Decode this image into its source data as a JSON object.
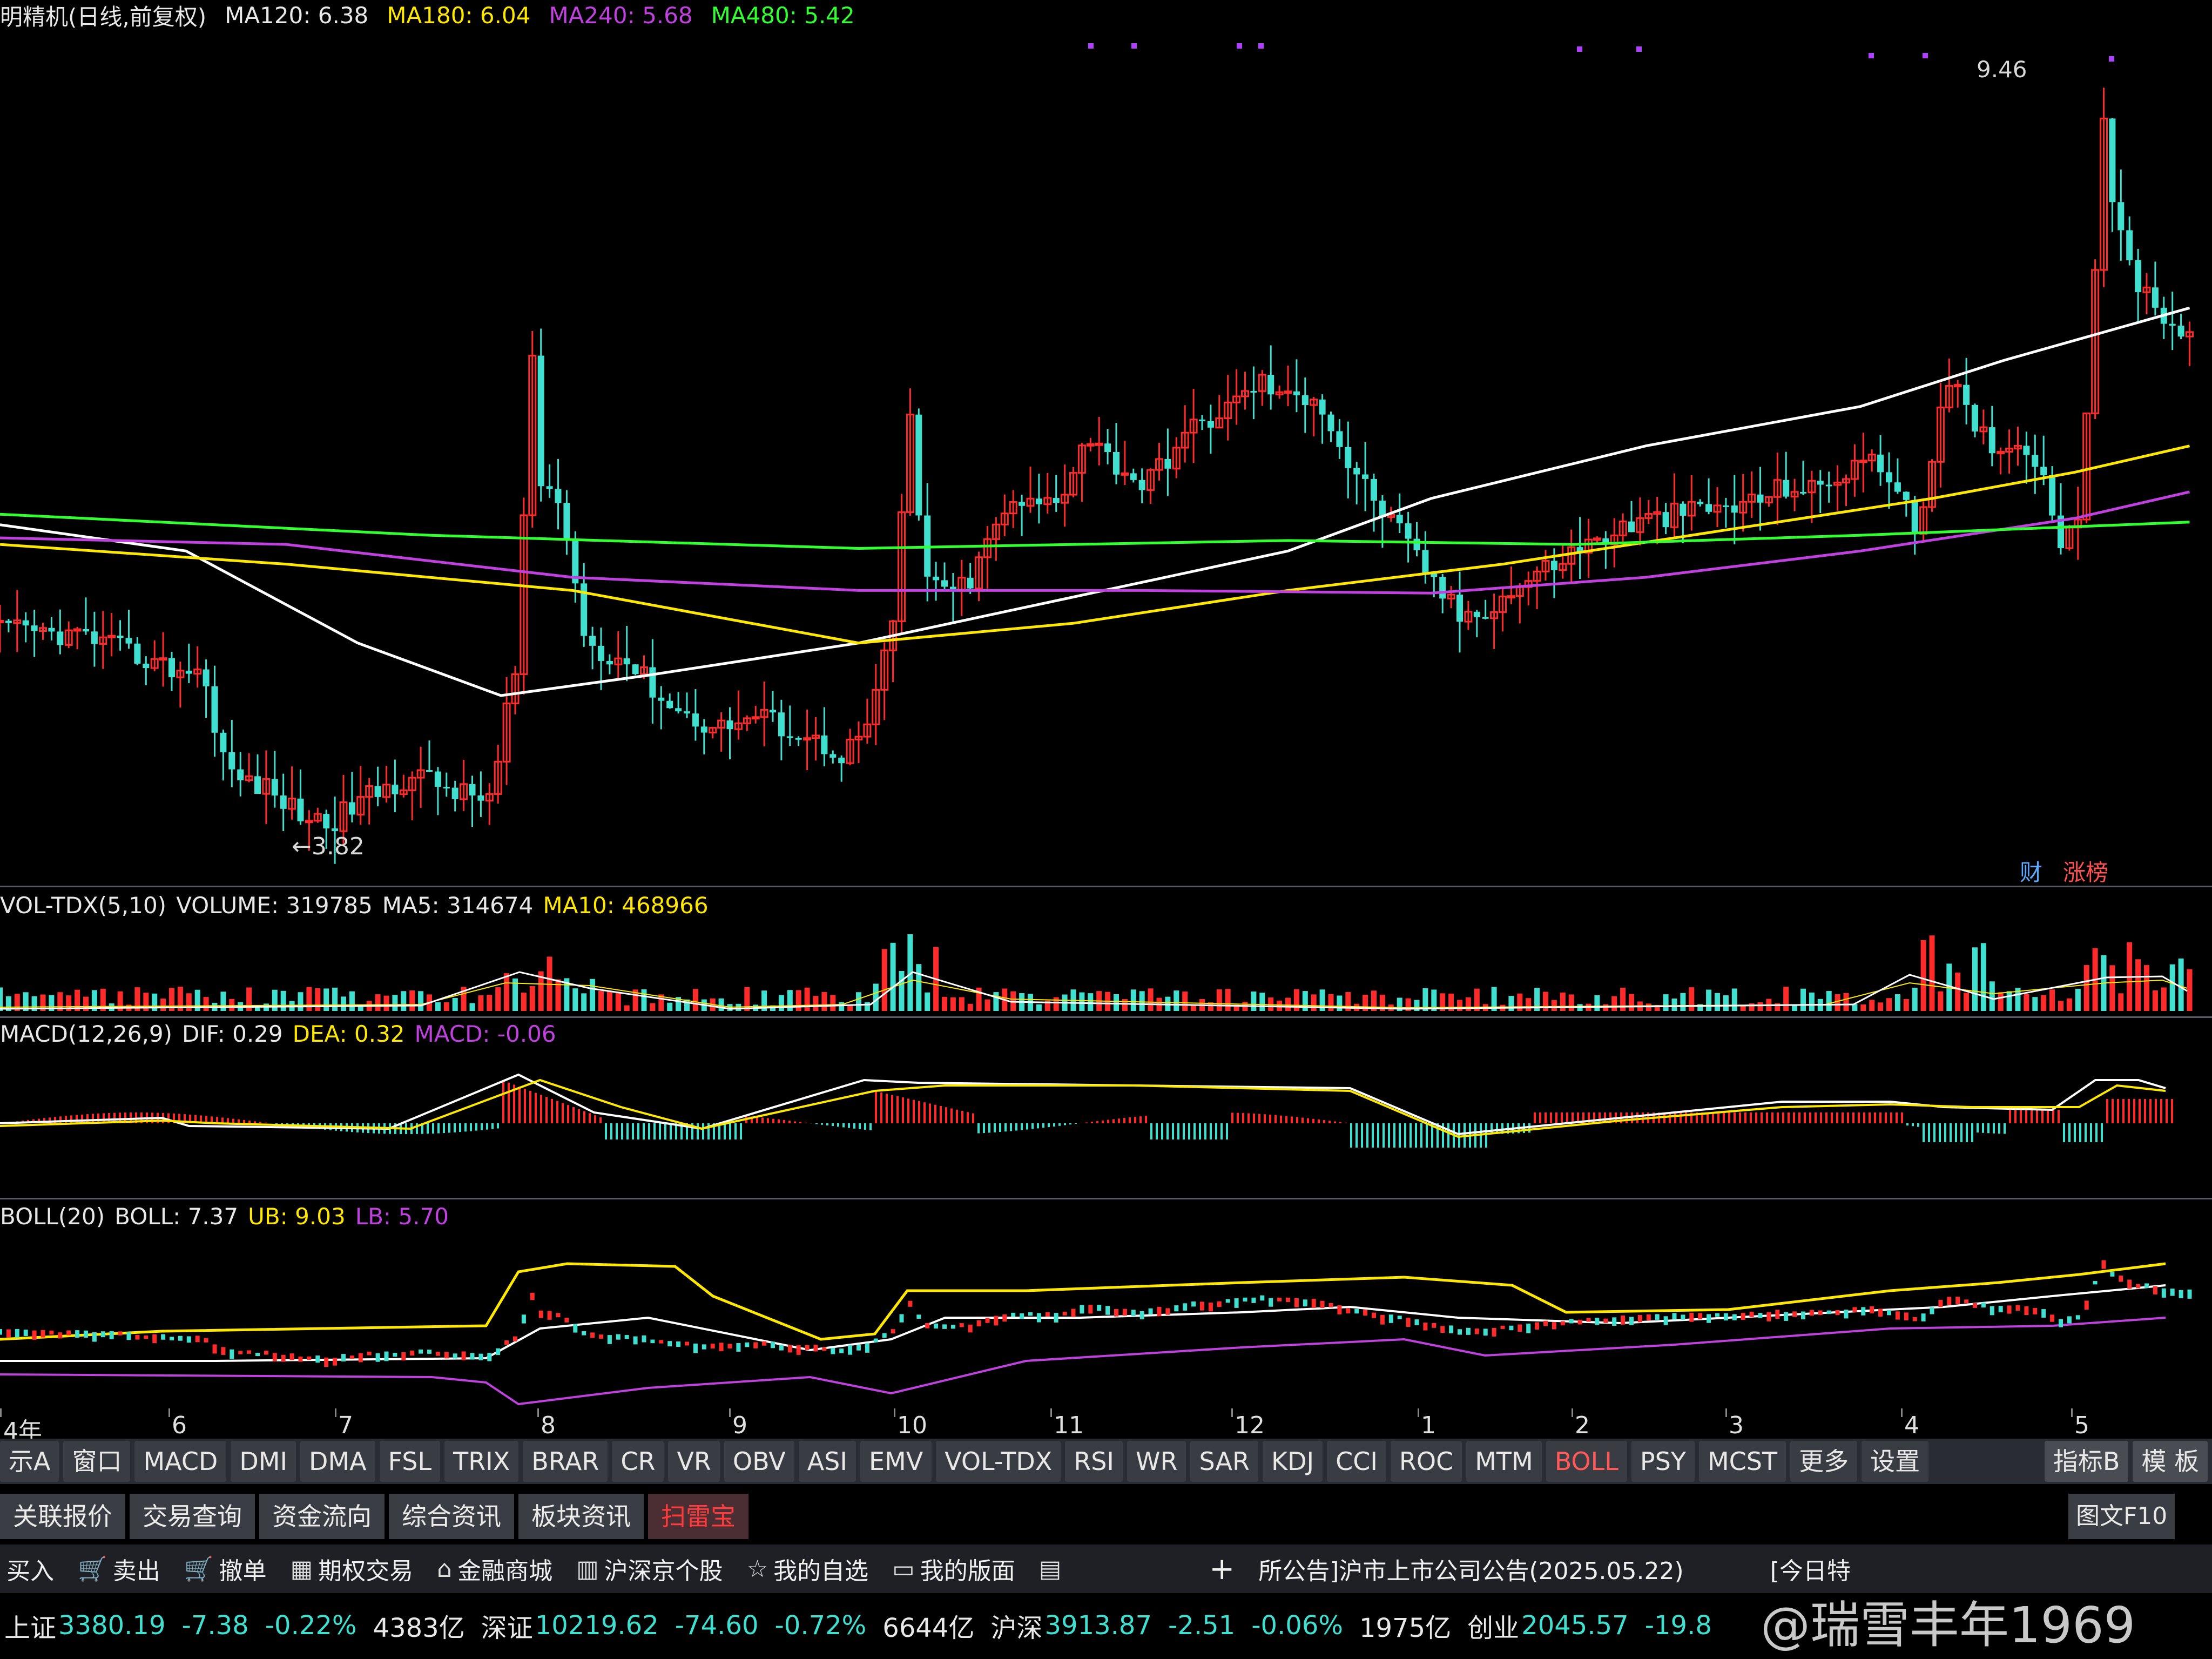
{
  "main_chart": {
    "title": "明精机(日线,前复权)",
    "ma120": "MA120: 6.38",
    "ma180": "MA180: 6.04",
    "ma240": "MA240: 5.68",
    "ma480": "MA480: 5.42",
    "high_label": "9.46",
    "low_label": "3.82",
    "badge_cai": "财",
    "badge_zhangbang": "涨榜",
    "colors": {
      "ma120": "#ffffff",
      "ma180": "#ffe800",
      "ma240": "#c040e0",
      "ma480": "#30ff30",
      "up": "#ff2a2a",
      "down": "#3fe0d0"
    }
  },
  "volume_panel": {
    "name": "VOL-TDX(5,10)",
    "volume": "VOLUME: 319785",
    "ma5": "MA5: 314674",
    "ma10": "MA10: 468966"
  },
  "macd_panel": {
    "name": "MACD(12,26,9)",
    "dif": "DIF: 0.29",
    "dea": "DEA: 0.32",
    "macd": "MACD: -0.06"
  },
  "boll_panel": {
    "name": "BOLL(20)",
    "boll": "BOLL: 7.37",
    "ub": "UB: 9.03",
    "lb": "LB: 5.70"
  },
  "time_axis": [
    "4年",
    "6",
    "7",
    "8",
    "9",
    "10",
    "11",
    "12",
    "1",
    "2",
    "3",
    "4",
    "5"
  ],
  "indicator_tabs": [
    "示A",
    "窗口",
    "MACD",
    "DMI",
    "DMA",
    "FSL",
    "TRIX",
    "BRAR",
    "CR",
    "VR",
    "OBV",
    "ASI",
    "EMV",
    "VOL-TDX",
    "RSI",
    "WR",
    "SAR",
    "KDJ",
    "CCI",
    "ROC",
    "MTM",
    "BOLL",
    "PSY",
    "MCST",
    "更多",
    "设置"
  ],
  "active_tab": "BOLL",
  "right_tabs": {
    "indicator_b": "指标B",
    "template": "模 板",
    "f10": "图文F10"
  },
  "sub_tabs": [
    "关联报价",
    "交易查询",
    "资金流向",
    "综合资讯",
    "板块资讯",
    "扫雷宝"
  ],
  "toolbar": {
    "buy": "买入",
    "sell": "卖出",
    "cancel": "撤单",
    "options": "期权交易",
    "mall": "金融商城",
    "hs_stocks": "沪深京个股",
    "my_watch": "我的自选",
    "my_layout": "我的版面",
    "plus": "+",
    "announcement": "所公告]沪市上市公司公告(2025.05.22)",
    "today_special": "[今日特"
  },
  "status": {
    "sh_name": "上证",
    "sh_val": "3380.19",
    "sh_chg": "-7.38",
    "sh_pct": "-0.22%",
    "sh_amt": "4383亿",
    "sz_name": "深证",
    "sz_val": "10219.62",
    "sz_chg": "-74.60",
    "sz_pct": "-0.72%",
    "sz_amt": "6644亿",
    "hs_name": "沪深",
    "hs_val": "3913.87",
    "hs_chg": "-2.51",
    "hs_pct": "-0.06%",
    "hs_amt": "1975亿",
    "cy_name": "创业",
    "cy_val": "2045.57",
    "cy_chg": "-19.8",
    "watermark": "@瑞雪丰年1969"
  }
}
